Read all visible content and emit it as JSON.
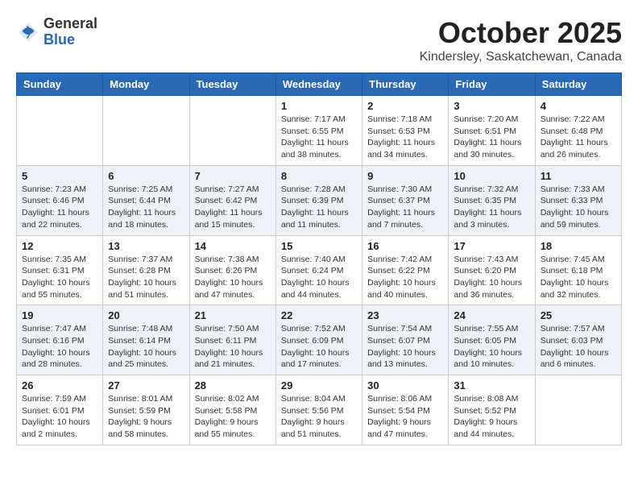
{
  "header": {
    "logo_general": "General",
    "logo_blue": "Blue",
    "title": "October 2025",
    "location": "Kindersley, Saskatchewan, Canada"
  },
  "weekdays": [
    "Sunday",
    "Monday",
    "Tuesday",
    "Wednesday",
    "Thursday",
    "Friday",
    "Saturday"
  ],
  "weeks": [
    [
      {
        "day": "",
        "info": ""
      },
      {
        "day": "",
        "info": ""
      },
      {
        "day": "",
        "info": ""
      },
      {
        "day": "1",
        "info": "Sunrise: 7:17 AM\nSunset: 6:55 PM\nDaylight: 11 hours\nand 38 minutes."
      },
      {
        "day": "2",
        "info": "Sunrise: 7:18 AM\nSunset: 6:53 PM\nDaylight: 11 hours\nand 34 minutes."
      },
      {
        "day": "3",
        "info": "Sunrise: 7:20 AM\nSunset: 6:51 PM\nDaylight: 11 hours\nand 30 minutes."
      },
      {
        "day": "4",
        "info": "Sunrise: 7:22 AM\nSunset: 6:48 PM\nDaylight: 11 hours\nand 26 minutes."
      }
    ],
    [
      {
        "day": "5",
        "info": "Sunrise: 7:23 AM\nSunset: 6:46 PM\nDaylight: 11 hours\nand 22 minutes."
      },
      {
        "day": "6",
        "info": "Sunrise: 7:25 AM\nSunset: 6:44 PM\nDaylight: 11 hours\nand 18 minutes."
      },
      {
        "day": "7",
        "info": "Sunrise: 7:27 AM\nSunset: 6:42 PM\nDaylight: 11 hours\nand 15 minutes."
      },
      {
        "day": "8",
        "info": "Sunrise: 7:28 AM\nSunset: 6:39 PM\nDaylight: 11 hours\nand 11 minutes."
      },
      {
        "day": "9",
        "info": "Sunrise: 7:30 AM\nSunset: 6:37 PM\nDaylight: 11 hours\nand 7 minutes."
      },
      {
        "day": "10",
        "info": "Sunrise: 7:32 AM\nSunset: 6:35 PM\nDaylight: 11 hours\nand 3 minutes."
      },
      {
        "day": "11",
        "info": "Sunrise: 7:33 AM\nSunset: 6:33 PM\nDaylight: 10 hours\nand 59 minutes."
      }
    ],
    [
      {
        "day": "12",
        "info": "Sunrise: 7:35 AM\nSunset: 6:31 PM\nDaylight: 10 hours\nand 55 minutes."
      },
      {
        "day": "13",
        "info": "Sunrise: 7:37 AM\nSunset: 6:28 PM\nDaylight: 10 hours\nand 51 minutes."
      },
      {
        "day": "14",
        "info": "Sunrise: 7:38 AM\nSunset: 6:26 PM\nDaylight: 10 hours\nand 47 minutes."
      },
      {
        "day": "15",
        "info": "Sunrise: 7:40 AM\nSunset: 6:24 PM\nDaylight: 10 hours\nand 44 minutes."
      },
      {
        "day": "16",
        "info": "Sunrise: 7:42 AM\nSunset: 6:22 PM\nDaylight: 10 hours\nand 40 minutes."
      },
      {
        "day": "17",
        "info": "Sunrise: 7:43 AM\nSunset: 6:20 PM\nDaylight: 10 hours\nand 36 minutes."
      },
      {
        "day": "18",
        "info": "Sunrise: 7:45 AM\nSunset: 6:18 PM\nDaylight: 10 hours\nand 32 minutes."
      }
    ],
    [
      {
        "day": "19",
        "info": "Sunrise: 7:47 AM\nSunset: 6:16 PM\nDaylight: 10 hours\nand 28 minutes."
      },
      {
        "day": "20",
        "info": "Sunrise: 7:48 AM\nSunset: 6:14 PM\nDaylight: 10 hours\nand 25 minutes."
      },
      {
        "day": "21",
        "info": "Sunrise: 7:50 AM\nSunset: 6:11 PM\nDaylight: 10 hours\nand 21 minutes."
      },
      {
        "day": "22",
        "info": "Sunrise: 7:52 AM\nSunset: 6:09 PM\nDaylight: 10 hours\nand 17 minutes."
      },
      {
        "day": "23",
        "info": "Sunrise: 7:54 AM\nSunset: 6:07 PM\nDaylight: 10 hours\nand 13 minutes."
      },
      {
        "day": "24",
        "info": "Sunrise: 7:55 AM\nSunset: 6:05 PM\nDaylight: 10 hours\nand 10 minutes."
      },
      {
        "day": "25",
        "info": "Sunrise: 7:57 AM\nSunset: 6:03 PM\nDaylight: 10 hours\nand 6 minutes."
      }
    ],
    [
      {
        "day": "26",
        "info": "Sunrise: 7:59 AM\nSunset: 6:01 PM\nDaylight: 10 hours\nand 2 minutes."
      },
      {
        "day": "27",
        "info": "Sunrise: 8:01 AM\nSunset: 5:59 PM\nDaylight: 9 hours\nand 58 minutes."
      },
      {
        "day": "28",
        "info": "Sunrise: 8:02 AM\nSunset: 5:58 PM\nDaylight: 9 hours\nand 55 minutes."
      },
      {
        "day": "29",
        "info": "Sunrise: 8:04 AM\nSunset: 5:56 PM\nDaylight: 9 hours\nand 51 minutes."
      },
      {
        "day": "30",
        "info": "Sunrise: 8:06 AM\nSunset: 5:54 PM\nDaylight: 9 hours\nand 47 minutes."
      },
      {
        "day": "31",
        "info": "Sunrise: 8:08 AM\nSunset: 5:52 PM\nDaylight: 9 hours\nand 44 minutes."
      },
      {
        "day": "",
        "info": ""
      }
    ]
  ]
}
